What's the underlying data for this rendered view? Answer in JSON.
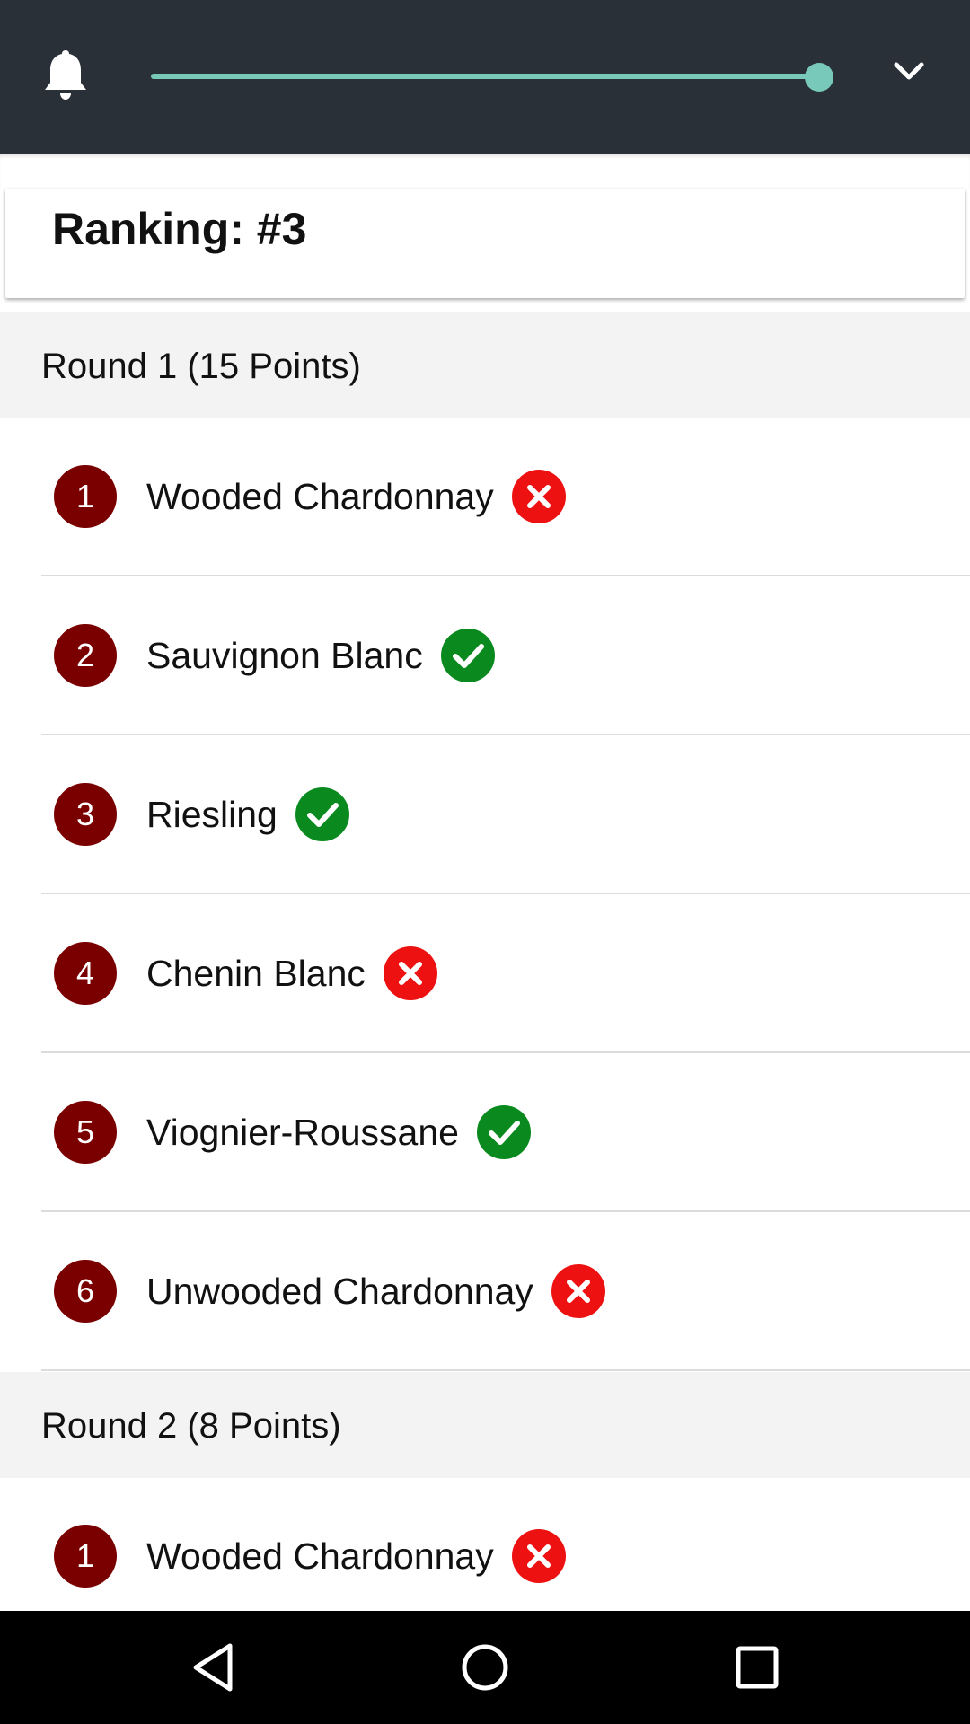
{
  "header": {
    "bell_icon": "bell-icon",
    "slider_value": 1.0,
    "chevron_icon": "chevron-down-icon",
    "accent_color": "#79c9bb",
    "background_color": "#293038"
  },
  "ranking": {
    "title": "Ranking: #3"
  },
  "rounds": [
    {
      "title": "Round 1 (15 Points)",
      "items": [
        {
          "number": "1",
          "name": "Wooded Chardonnay",
          "status": "incorrect"
        },
        {
          "number": "2",
          "name": "Sauvignon Blanc",
          "status": "correct"
        },
        {
          "number": "3",
          "name": "Riesling",
          "status": "correct"
        },
        {
          "number": "4",
          "name": "Chenin Blanc",
          "status": "incorrect"
        },
        {
          "number": "5",
          "name": "Viognier-Roussane",
          "status": "correct"
        },
        {
          "number": "6",
          "name": "Unwooded Chardonnay",
          "status": "incorrect"
        }
      ]
    },
    {
      "title": "Round 2 (8 Points)",
      "items": [
        {
          "number": "1",
          "name": "Wooded Chardonnay",
          "status": "incorrect"
        }
      ]
    }
  ],
  "colors": {
    "badge": "#7a0000",
    "correct": "#0a8a1e",
    "incorrect": "#ee1111",
    "section_bg": "#f3f3f3"
  },
  "navbar": {
    "back_icon": "back-icon",
    "home_icon": "home-icon",
    "recents_icon": "recents-icon"
  }
}
